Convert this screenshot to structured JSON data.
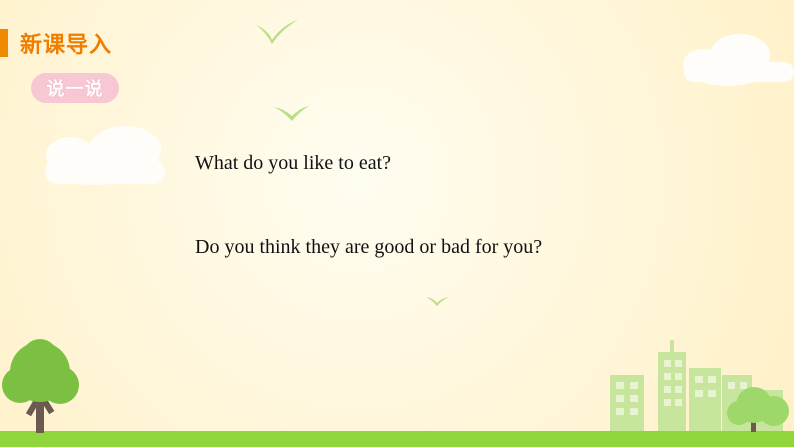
{
  "header": {
    "title": "新课导入"
  },
  "badge": {
    "label": "说一说"
  },
  "questions": [
    "What do you like to eat?",
    "Do you think they are good or bad for you?"
  ],
  "theme": {
    "accent": "#ef7d00",
    "badge_pink": "#f7c7d3",
    "grass_green": "#8ed63b",
    "tree_green": "#7cc043",
    "building_green": "#c7e59d",
    "bird_green": "#b8df84"
  }
}
